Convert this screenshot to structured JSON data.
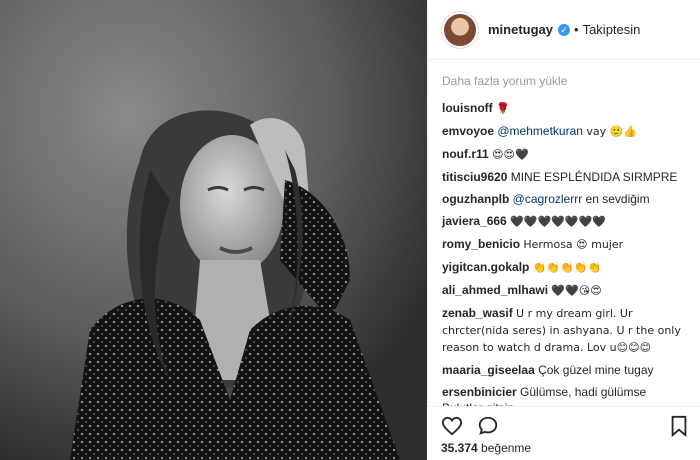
{
  "post": {
    "username": "minetugay",
    "follow_label": "Takiptesin",
    "load_more": "Daha fazla yorum yükle",
    "likes_count": "35.374",
    "likes_label": "beğenme"
  },
  "comments": [
    {
      "user": "louisnoff",
      "text": "🌹"
    },
    {
      "user": "emvoyoe",
      "mention": "@mehmetkuran",
      "text": " vay 🙂👍"
    },
    {
      "user": "nouf.r11",
      "text": "😍😍🖤"
    },
    {
      "user": "titisciu9620",
      "text": "MINE ESPLÉNDIDA SIRMPRE"
    },
    {
      "user": "oguzhanplb",
      "mention": "@cagrozlerrr",
      "text": " en sevdiğim"
    },
    {
      "user": "javiera_666",
      "text": "🖤🖤🖤🖤🖤🖤🖤"
    },
    {
      "user": "romy_benicio",
      "text": "Hermosa 😍 mujer"
    },
    {
      "user": "yigitcan.gokalp",
      "text": "👏👏👏👏👏"
    },
    {
      "user": "ali_ahmed_mlhawi",
      "text": "🖤🖤😘😍"
    },
    {
      "user": "zenab_wasif",
      "text": "U r my dream girl. Ur chrcter(nida seres) in ashyana. U r the only reason to watch d drama. Lov u😊😊😊"
    },
    {
      "user": "maaria_giseelaa",
      "text": "Çok güzel mine tugay"
    },
    {
      "user": "ersenbinicier",
      "text": "Gülümse, hadi gülümse Bulutlar gitsin"
    }
  ],
  "icons": [
    "heart-icon",
    "comment-icon",
    "bookmark-icon"
  ],
  "colors": {
    "verified": "#3897f0",
    "mention": "#003569",
    "muted": "#999999"
  }
}
